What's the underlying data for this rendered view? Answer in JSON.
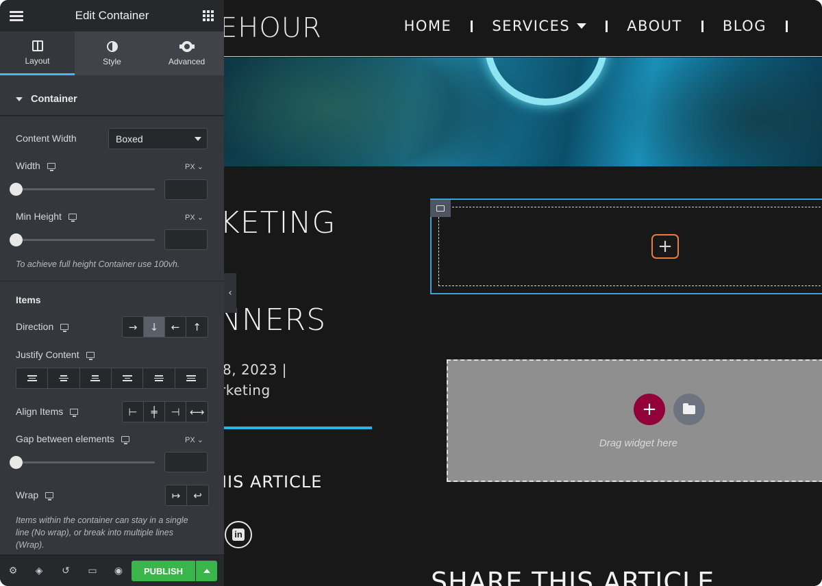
{
  "panel": {
    "title": "Edit Container",
    "tabs": [
      {
        "label": "Layout",
        "icon": "layout-icon",
        "active": true
      },
      {
        "label": "Style",
        "icon": "style-icon",
        "active": false
      },
      {
        "label": "Advanced",
        "icon": "gear-icon",
        "active": false
      }
    ],
    "section_title": "Container",
    "content_width": {
      "label": "Content Width",
      "value": "Boxed"
    },
    "width": {
      "label": "Width",
      "unit": "PX"
    },
    "min_height": {
      "label": "Min Height",
      "unit": "PX",
      "hint": "To achieve full height Container use 100vh."
    },
    "items_heading": "Items",
    "direction": {
      "label": "Direction",
      "options": [
        "→",
        "↓",
        "←",
        "↑"
      ],
      "selected": "↓"
    },
    "justify_content": {
      "label": "Justify Content"
    },
    "align_items": {
      "label": "Align Items"
    },
    "gap": {
      "label": "Gap between elements",
      "unit": "PX"
    },
    "wrap": {
      "label": "Wrap",
      "hint": "Items within the container can stay in a single line (No wrap), or break into multiple lines (Wrap)."
    },
    "footer": {
      "publish_label": "PUBLISH"
    }
  },
  "site": {
    "logo_text": "EHOUR",
    "nav": [
      {
        "label": "HOME"
      },
      {
        "label": "SERVICES",
        "has_dropdown": true
      },
      {
        "label": "ABOUT"
      },
      {
        "label": "BLOG"
      }
    ],
    "title_line1": "KETING",
    "title_line2": "NNERS",
    "meta_date": "8, 2023 |",
    "meta_category": "rketing",
    "share_small": "HIS ARTICLE",
    "share_big": "SHARE THIS ARTICLE",
    "linkedin_letters": "in",
    "drop_zone_text": "Drag widget here"
  },
  "colors": {
    "accent": "#4ab7f4",
    "publish": "#39b54a",
    "add_widget": "#93013a",
    "container_outline": "#3aa4d8",
    "add_button_border": "#ea7c42"
  }
}
